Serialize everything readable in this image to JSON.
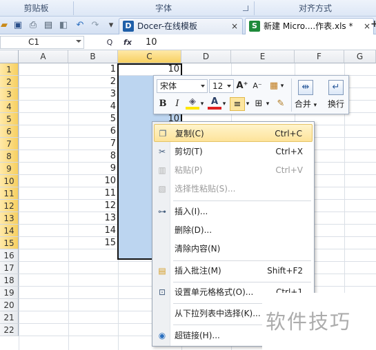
{
  "ribbon": {
    "groups": [
      "剪贴板",
      "字体",
      "对齐方式"
    ]
  },
  "toolbar": {
    "quick_access_icons": [
      "open-folder-icon",
      "save-icon",
      "print-icon",
      "print-preview-icon",
      "undo-icon",
      "redo-icon",
      "customize-icon"
    ],
    "tabs": [
      {
        "label": "Docer-在线模板",
        "close": "×",
        "icon": "D",
        "icon_color": "#1f5fa8"
      },
      {
        "label": "新建 Micro....作表.xls *",
        "close": "×",
        "icon": "S",
        "icon_color": "#1e8a3a"
      }
    ],
    "new_tab": "+"
  },
  "formula_bar": {
    "name_box": "C1",
    "fx_label": "fx",
    "zoom_label": "Q",
    "value": "10"
  },
  "grid": {
    "columns": [
      "A",
      "B",
      "C",
      "D",
      "E",
      "F",
      "G"
    ],
    "active_column": "C",
    "rows": [
      "1",
      "2",
      "3",
      "4",
      "5",
      "6",
      "7",
      "8",
      "9",
      "10",
      "11",
      "12",
      "13",
      "14",
      "15",
      "16",
      "17",
      "18",
      "19",
      "20",
      "21",
      "22"
    ],
    "active_rows": 15,
    "col_b_values": [
      "1",
      "2",
      "3",
      "4",
      "5",
      "6",
      "7",
      "8",
      "9",
      "10",
      "11",
      "12",
      "13",
      "14",
      "15"
    ],
    "col_c_values": [
      "10",
      "",
      "",
      "",
      "10"
    ]
  },
  "mini_toolbar": {
    "font_name": "宋体",
    "font_size": "12",
    "grow_font": "A⁺",
    "shrink_font": "A⁻",
    "bold": "B",
    "italic": "I",
    "font_color": "A",
    "merge_label": "合并",
    "wrap_label": "换行",
    "fill_color": "#ffe600",
    "text_color": "#e02020"
  },
  "context_menu": {
    "items": [
      {
        "label": "复制(C)",
        "shortcut": "Ctrl+C",
        "icon": "copy-icon",
        "enabled": true,
        "highlighted": true
      },
      {
        "label": "剪切(T)",
        "shortcut": "Ctrl+X",
        "icon": "cut-icon",
        "enabled": true
      },
      {
        "label": "粘贴(P)",
        "shortcut": "Ctrl+V",
        "icon": "paste-icon",
        "enabled": false
      },
      {
        "label": "选择性粘贴(S)...",
        "shortcut": "",
        "icon": "paste-special-icon",
        "enabled": false
      },
      {
        "label": "插入(I)...",
        "shortcut": "",
        "icon": "insert-icon",
        "enabled": true
      },
      {
        "label": "删除(D)...",
        "shortcut": "",
        "icon": "",
        "enabled": true
      },
      {
        "label": "清除内容(N)",
        "shortcut": "",
        "icon": "",
        "enabled": true
      },
      {
        "label": "插入批注(M)",
        "shortcut": "Shift+F2",
        "icon": "comment-icon",
        "enabled": true
      },
      {
        "label": "设置单元格格式(O)...",
        "shortcut": "Ctrl+1",
        "icon": "format-cells-icon",
        "enabled": true
      },
      {
        "label": "从下拉列表中选择(K)...",
        "shortcut": "",
        "icon": "",
        "enabled": true
      },
      {
        "label": "超链接(H)...",
        "shortcut": "",
        "icon": "hyperlink-icon",
        "enabled": true
      }
    ]
  },
  "watermark": "软件技巧"
}
